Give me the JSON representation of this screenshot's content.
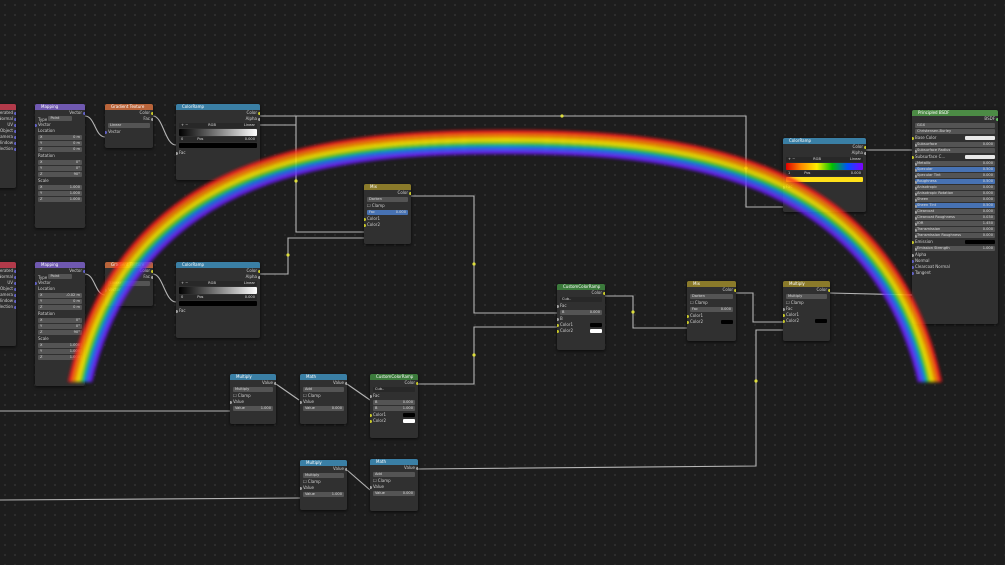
{
  "node_titles": {
    "mapping": "Mapping",
    "gradient": "Gradient Texture",
    "colorramp": "ColorRamp",
    "mix": "Mix",
    "mix2": "Mix",
    "multiply": "Multiply",
    "math": "Math",
    "custom_ramp": "CustomColorRamp",
    "custom_ramp2": "CustomColorRamp",
    "principled": "Principled BSDF",
    "math2": "Math"
  },
  "socket_labels": {
    "vector": "Vector",
    "color": "Color",
    "fac": "Fac",
    "alpha": "Alpha",
    "value": "Value",
    "bsdf": "BSDF",
    "location": "Location",
    "rotation": "Rotation",
    "scale": "Scale",
    "type": "Type",
    "clamp": "Clamp",
    "color1": "Color1",
    "color2": "Color2",
    "b": "B"
  },
  "mapping": {
    "type_value": "Point",
    "loc": [
      "0 m",
      "0 m",
      "0 m"
    ],
    "loc_alt": [
      "-0.02 m",
      "0 m",
      "0 m"
    ],
    "rot": [
      "0°",
      "0°",
      "90°"
    ],
    "scale": [
      "1.000",
      "1.000",
      "1.000"
    ],
    "axis": [
      "X",
      "Y",
      "Z"
    ]
  },
  "gradient": {
    "mode": "Linear"
  },
  "colorramp": {
    "mode": "RGB",
    "interp": "Linear",
    "index": "0",
    "pos_label": "Pos",
    "pos_value": "0.000",
    "index2": "1",
    "pos_value2": "0.000"
  },
  "mix": {
    "blend": "Darken",
    "clamp": "Clamp",
    "fac": "0.000"
  },
  "mix2": {
    "blend": "Darken",
    "clamp": "Clamp",
    "fac": "0.000"
  },
  "multiply_node": {
    "op": "Multiply",
    "clamp": "Clamp",
    "value_label": "Value",
    "value": "1.000"
  },
  "math_node": {
    "op": "Add",
    "clamp": "Clamp",
    "value_label": "Value",
    "value": "0.000"
  },
  "custom": {
    "mode": "Cub..",
    "fac_label": "Fac",
    "b_label": "B",
    "b_value": "0.000",
    "c1": "0.000",
    "c2": "1.000"
  },
  "principled": {
    "dist": "GGX",
    "sss": "Christensen-Burley",
    "rows": [
      "Base Color",
      "Subsurface",
      "Subsurface Radius",
      "Subsurface C...",
      "Metallic",
      "Specular",
      "Specular Tint",
      "Roughness",
      "Anisotropic",
      "Anisotropic Rotation",
      "Sheen",
      "Sheen Tint",
      "Clearcoat",
      "Clearcoat Roughness",
      "IOR",
      "Transmission",
      "Transmission Roughness",
      "Emission",
      "Emission Strength",
      "Alpha",
      "Normal",
      "Clearcoat Normal",
      "Tangent"
    ],
    "values": [
      "",
      "0.000",
      "",
      "",
      "0.000",
      "0.500",
      "0.000",
      "0.500",
      "0.000",
      "0.000",
      "0.000",
      "0.500",
      "0.000",
      "0.030",
      "1.450",
      "0.000",
      "0.000",
      "",
      "1.000",
      "",
      "",
      "",
      ""
    ]
  },
  "left_out": {
    "rows": [
      "Generated",
      "Normal",
      "UV",
      "Object",
      "Camera",
      "Window",
      "Reflection"
    ]
  },
  "colors": {
    "mapping_header": "#6f58b0",
    "texture_header": "#b9643a",
    "converter_header": "#3a7fa5",
    "color_header": "#8a7a2a",
    "group_header": "#3b7a3b",
    "shader_header": "#4c8b45",
    "output_header": "#b23a4a",
    "link": "#b8b8b8",
    "ramp_yellow": "#ffe11a"
  }
}
